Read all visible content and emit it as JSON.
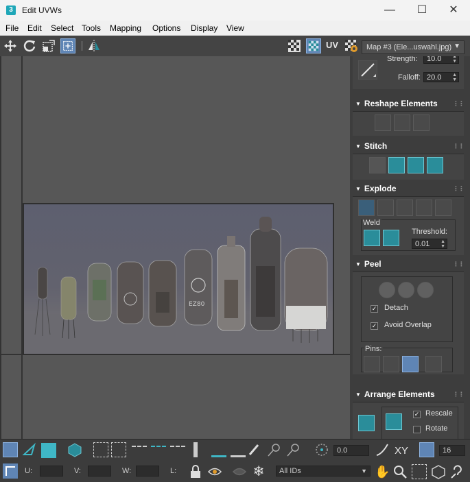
{
  "window": {
    "title": "Edit UVWs",
    "app_icon": "3"
  },
  "menu": [
    "File",
    "Edit",
    "Select",
    "Tools",
    "Mapping",
    "Options",
    "Display",
    "View"
  ],
  "toolbar": {
    "uv_label": "UV",
    "map_select": "Map #3 (Ele...uswahl.jpg)"
  },
  "soft_select": {
    "strength_label": "Strength:",
    "strength_value": "10.0",
    "falloff_label": "Falloff:",
    "falloff_value": "20.0"
  },
  "panels": {
    "reshape": "Reshape Elements",
    "stitch": "Stitch",
    "explode": "Explode",
    "weld_label": "Weld",
    "threshold_label": "Threshold:",
    "threshold_value": "0.01",
    "peel": "Peel",
    "detach_label": "Detach",
    "avoid_overlap_label": "Avoid Overlap",
    "pins_label": "Pins:",
    "arrange": "Arrange Elements",
    "rescale_label": "Rescale",
    "rotate_label": "Rotate"
  },
  "checks": {
    "detach": true,
    "avoid_overlap": true,
    "rescale": true,
    "rotate": false
  },
  "bottom": {
    "angle_value": "0.0",
    "xy_label": "XY",
    "grid_value": "16",
    "u_label": "U:",
    "v_label": "V:",
    "w_label": "W:",
    "l_label": "L:",
    "id_select": "All IDs"
  },
  "colors": {
    "accent_teal": "#2a8d9a",
    "selected_blue": "#5f85b5",
    "viewport": "#575757",
    "panel_bg": "#3d3d3d"
  }
}
